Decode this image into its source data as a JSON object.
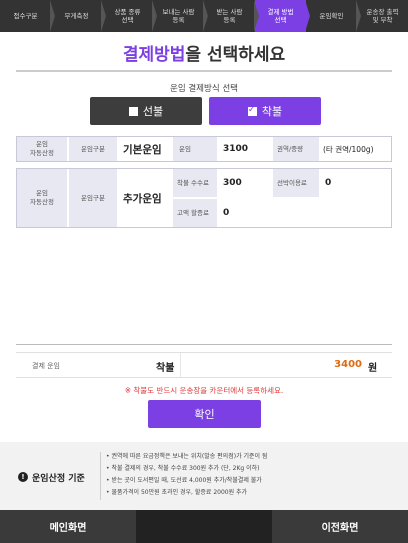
{
  "steps": [
    {
      "label": "접수구분"
    },
    {
      "label": "무게측정"
    },
    {
      "label": "상품 종류\n선택"
    },
    {
      "label": "보내는 사람\n등록"
    },
    {
      "label": "받는 사람\n등록"
    },
    {
      "label": "결제 방법\n선택"
    },
    {
      "label": "운임확인"
    },
    {
      "label": "운송장 출력\n및 부착"
    }
  ],
  "title": {
    "highlight": "결제방법",
    "rest": "을 선택하세요"
  },
  "payment": {
    "heading": "운임 결제방식 선택",
    "prepaid_label": "선불",
    "collect_label": "착불",
    "selected": "착불"
  },
  "table1": {
    "section_label": "운임\n자동산정",
    "type_label": "운임구분",
    "type_value": "기본운임",
    "fare_label": "운임",
    "fare_value": "3100",
    "zone_label": "권역/중량",
    "zone_value": "(타 권역/100g)"
  },
  "table2": {
    "section_label": "운임\n자동산정",
    "type_label": "운임구분",
    "type_value": "추가운임",
    "cod_fee_label": "착불 수수료",
    "cod_fee_value": "300",
    "island_label": "선박이용료",
    "island_value": "0",
    "surcharge_label": "고액 할증료",
    "surcharge_value": "0"
  },
  "fee": {
    "label": "결제 운임",
    "type": "착불",
    "amount": "3400",
    "unit": "원"
  },
  "warning": "※ 착불도 반드시 운송장을 카운터에서 등록하세요.",
  "confirm_label": "확인",
  "basis": {
    "title": "운임산정 기준",
    "items": [
      "• 권역에 따른 요금정책은 보내는 위치(발송 편의점)가 기준이 됨",
      "• 착불 결제의 경우, 착불 수수료 300원 추가 (단, 2Kg 이하)",
      "• 받는 곳이 도서편일 때, 도선료 4,000원 추가/착불결제 불가",
      "• 물품가격이 50만원 초과인 경우, 할증료 2000원 추가"
    ]
  },
  "footer": {
    "main_label": "메인화면",
    "prev_label": "이전화면"
  },
  "colors": {
    "accent": "#7b3fe4",
    "dark": "#333333",
    "amount": "#e06a10",
    "warning": "#e23a3a"
  }
}
